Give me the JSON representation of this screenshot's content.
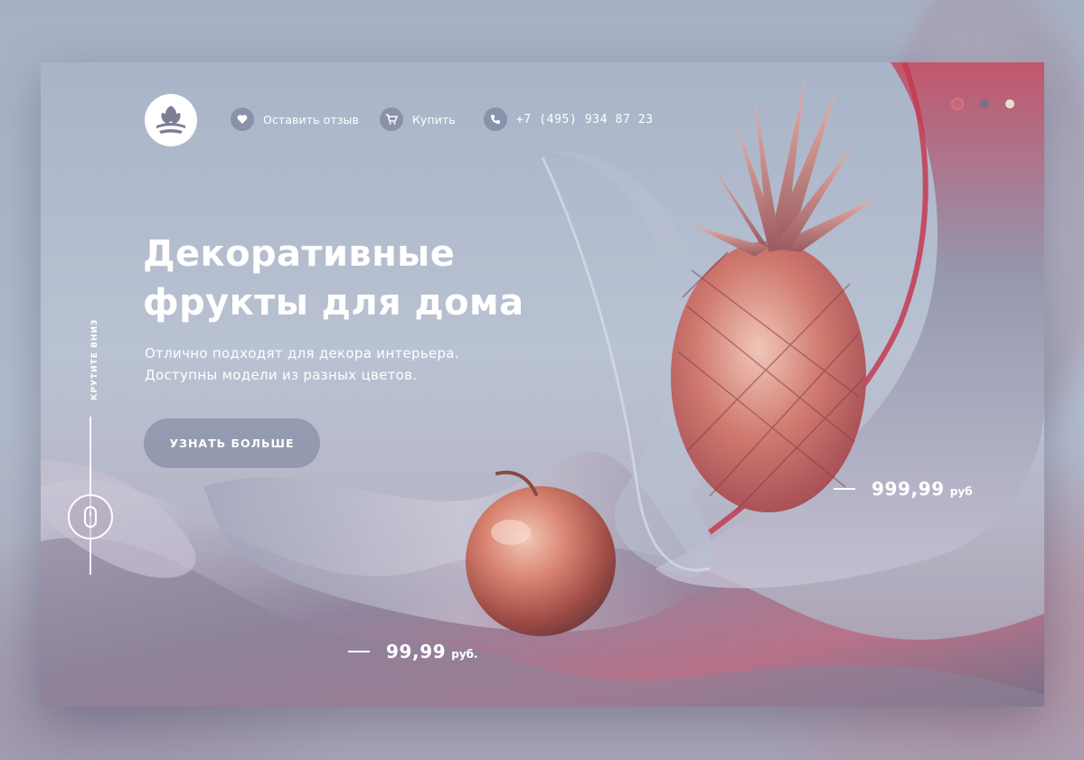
{
  "header": {
    "logo": "leaf-logo",
    "nav": [
      {
        "icon": "heart-icon",
        "label": "Оставить отзыв"
      },
      {
        "icon": "cart-icon",
        "label": "Купить"
      },
      {
        "icon": "phone-icon",
        "label": "+7 (495) 934 87 23"
      }
    ]
  },
  "slider": {
    "dots": 3,
    "active": 1
  },
  "hero": {
    "title_line1": "Декоративные",
    "title_line2": "фрукты для дома",
    "subtitle_line1": "Отлично подходят для декора интерьера.",
    "subtitle_line2": "Доступны модели из разных цветов.",
    "cta_label": "УЗНАТЬ БОЛЬШЕ"
  },
  "scroll": {
    "label": "КРУТИТЕ ВНИЗ",
    "icon": "mouse-icon"
  },
  "products": [
    {
      "name": "pineapple",
      "price": "999,99",
      "currency": "руб"
    },
    {
      "name": "apple",
      "price": "99,99",
      "currency": "руб."
    }
  ],
  "colors": {
    "accent_pink": "#d9747f",
    "dot_mid": "#7b6f86",
    "dot_light": "#e6e1cf",
    "text": "#ffffff"
  }
}
